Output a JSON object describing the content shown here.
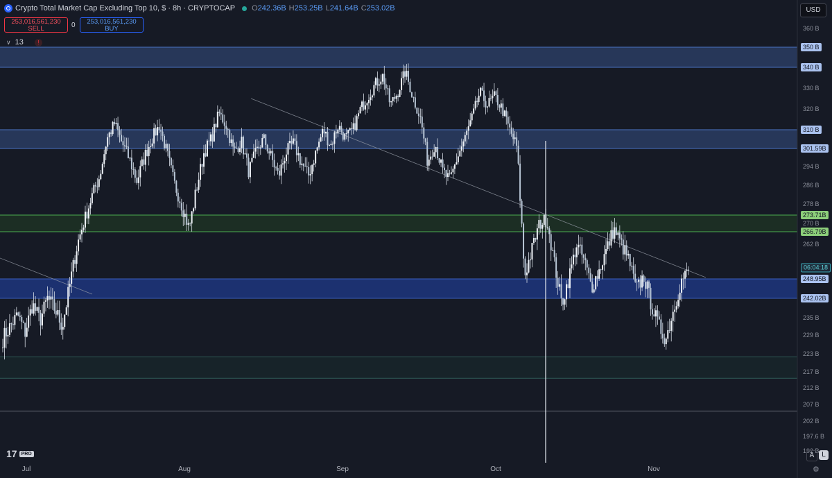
{
  "header": {
    "title": "Crypto Total Market Cap Excluding Top 10, $ · 8h · CRYPTOCAP",
    "ohlc": [
      {
        "key": "O",
        "value": "242.36B"
      },
      {
        "key": "H",
        "value": "253.25B"
      },
      {
        "key": "L",
        "value": "241.64B"
      },
      {
        "key": "C",
        "value": "253.02B"
      }
    ]
  },
  "trade": {
    "sell_price": "253,016,561,230",
    "sell_label": "SELL",
    "spread": "0",
    "buy_price": "253,016,561,230",
    "buy_label": "BUY"
  },
  "indicator": {
    "count": "13",
    "warn": "!"
  },
  "currency": "USD",
  "toolbar": {
    "auto": "A",
    "log": "L"
  },
  "logo": {
    "pro": "PRO"
  },
  "colors": {
    "bg": "#161a25",
    "candle": "#e0e6ef",
    "zone_blue": "#4a73c2",
    "zone_green": "#4caf50",
    "zone_teal": "#1f3a3a"
  },
  "chart_data": {
    "type": "candlestick",
    "title": "Crypto Total Market Cap Excluding Top 10, $",
    "x_labels": [
      "Jul",
      "Aug",
      "Sep",
      "Oct",
      "Nov"
    ],
    "y_ticks": [
      "360 B",
      "340 B",
      "330 B",
      "320 B",
      "310 B",
      "301.59B",
      "294 B",
      "286 B",
      "278 B",
      "270 B",
      "262 B",
      "248.95B",
      "242.02B",
      "235 B",
      "229 B",
      "223 B",
      "217 B",
      "212 B",
      "207 B",
      "202 B",
      "197.6 B",
      "192 B"
    ],
    "price_tags": [
      {
        "label": "350 B",
        "style": "blue"
      },
      {
        "label": "340 B",
        "style": "blue"
      },
      {
        "label": "310 B",
        "style": "blue"
      },
      {
        "label": "301.59B",
        "style": "blue"
      },
      {
        "label": "273.71B",
        "style": "green"
      },
      {
        "label": "266.79B",
        "style": "green"
      },
      {
        "label": "06:04:18",
        "style": "countdown"
      },
      {
        "label": "248.95B",
        "style": "blue"
      },
      {
        "label": "242.02B",
        "style": "blue"
      }
    ],
    "zones": [
      {
        "from": 340,
        "to": 350,
        "color": "blue"
      },
      {
        "from": 301.59,
        "to": 310,
        "color": "blue"
      },
      {
        "from": 266.79,
        "to": 273.71,
        "color": "green"
      },
      {
        "from": 242.02,
        "to": 248.95,
        "color": "blue_dark"
      },
      {
        "from": 215,
        "to": 222,
        "color": "teal"
      }
    ],
    "hlines": [
      205
    ],
    "close_series": [
      228,
      232,
      236,
      230,
      240,
      234,
      242,
      238,
      232,
      247,
      262,
      272,
      282,
      290,
      306,
      313,
      304,
      297,
      288,
      298,
      306,
      312,
      300,
      287,
      278,
      268,
      285,
      300,
      306,
      318,
      312,
      300,
      305,
      292,
      300,
      306,
      298,
      290,
      300,
      304,
      296,
      290,
      300,
      310,
      303,
      312,
      306,
      310,
      320,
      326,
      332,
      336,
      322,
      328,
      338,
      326,
      316,
      296,
      304,
      292,
      288,
      298,
      306,
      316,
      328,
      322,
      326,
      320,
      310,
      302,
      250,
      260,
      270,
      272,
      255,
      240,
      250,
      262,
      256,
      246,
      252,
      260,
      268,
      262,
      256,
      245,
      250,
      240,
      232,
      228,
      238,
      248,
      252
    ]
  }
}
